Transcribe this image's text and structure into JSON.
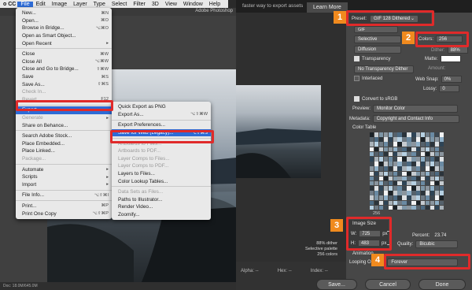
{
  "app": {
    "title": "Adobe Photoshop",
    "cc_tag": "o CC",
    "status": "Doc: 18.0M/645.0M"
  },
  "menubar": [
    "File",
    "Edit",
    "Image",
    "Layer",
    "Type",
    "Select",
    "Filter",
    "3D",
    "View",
    "Window",
    "Help"
  ],
  "file_menu": [
    {
      "label": "New...",
      "sc": "⌘N"
    },
    {
      "label": "Open...",
      "sc": "⌘O"
    },
    {
      "label": "Browse in Bridge...",
      "sc": "⌥⌘O"
    },
    {
      "label": "Open as Smart Object...",
      "sc": ""
    },
    {
      "label": "Open Recent",
      "sc": "▸"
    },
    {
      "sep": true
    },
    {
      "label": "Close",
      "sc": "⌘W"
    },
    {
      "label": "Close All",
      "sc": "⌥⌘W"
    },
    {
      "label": "Close and Go to Bridge...",
      "sc": "⇧⌘W"
    },
    {
      "label": "Save",
      "sc": "⌘S"
    },
    {
      "label": "Save As...",
      "sc": "⇧⌘S"
    },
    {
      "label": "Check In...",
      "sc": "",
      "dis": true
    },
    {
      "label": "Revert",
      "sc": "F12",
      "dis": true
    },
    {
      "sep": true
    },
    {
      "label": "Export",
      "sc": "▸",
      "hl": true
    },
    {
      "label": "Generate",
      "sc": "▸",
      "dis": true
    },
    {
      "label": "Share on Behance...",
      "sc": ""
    },
    {
      "sep": true
    },
    {
      "label": "Search Adobe Stock...",
      "sc": ""
    },
    {
      "label": "Place Embedded...",
      "sc": ""
    },
    {
      "label": "Place Linked...",
      "sc": ""
    },
    {
      "label": "Package...",
      "sc": "",
      "dis": true
    },
    {
      "sep": true
    },
    {
      "label": "Automate",
      "sc": "▸"
    },
    {
      "label": "Scripts",
      "sc": "▸"
    },
    {
      "label": "Import",
      "sc": "▸"
    },
    {
      "sep": true
    },
    {
      "label": "File Info...",
      "sc": "⌥⇧⌘I"
    },
    {
      "sep": true
    },
    {
      "label": "Print...",
      "sc": "⌘P"
    },
    {
      "label": "Print One Copy",
      "sc": "⌥⇧⌘P"
    }
  ],
  "export_menu": [
    {
      "label": "Quick Export as PNG",
      "sc": ""
    },
    {
      "label": "Export As...",
      "sc": "⌥⇧⌘W"
    },
    {
      "sep": true
    },
    {
      "label": "Export Preferences...",
      "sc": ""
    },
    {
      "label": "Save for Web (Legacy)...",
      "sc": "⌥⇧⌘S",
      "hl": true
    },
    {
      "sep": true
    },
    {
      "label": "Artboards to Files...",
      "sc": "",
      "dis": true
    },
    {
      "label": "Artboards to PDF...",
      "sc": "",
      "dis": true
    },
    {
      "label": "Layer Comps to Files...",
      "sc": "",
      "dis": true
    },
    {
      "label": "Layer Comps to PDF...",
      "sc": "",
      "dis": true
    },
    {
      "label": "Layers to Files...",
      "sc": ""
    },
    {
      "label": "Color Lookup Tables...",
      "sc": ""
    },
    {
      "sep": true
    },
    {
      "label": "Data Sets as Files...",
      "sc": "",
      "dis": true
    },
    {
      "label": "Paths to Illustrator...",
      "sc": ""
    },
    {
      "label": "Render Video...",
      "sc": ""
    },
    {
      "label": "Zoomify...",
      "sc": ""
    }
  ],
  "sfw": {
    "hint": "faster way to export assets",
    "learn_more": "Learn More",
    "preset_label": "Preset:",
    "preset_value": "GIF 128 Dithered",
    "format": "GIF",
    "reduction": "Selective",
    "colors_label": "Colors:",
    "colors_value": "256",
    "dither_algo": "Diffusion",
    "dither_label": "Dither:",
    "dither_value": "88%",
    "transparency": "Transparency",
    "matte_label": "Matte:",
    "trans_dither": "No Transparency Dither",
    "amount_label": "Amount:",
    "interlaced": "Interlaced",
    "websnap_label": "Web Snap:",
    "websnap_value": "0%",
    "lossy_label": "Lossy:",
    "lossy_value": "0",
    "convert_srgb": "Convert to sRGB",
    "preview_label": "Preview:",
    "preview_value": "Monitor Color",
    "metadata_label": "Metadata:",
    "metadata_value": "Copyright and Contact Info",
    "color_table": "Color Table",
    "count": "256",
    "image_size": "Image Size",
    "w_label": "W:",
    "w_value": "725",
    "h_label": "H:",
    "h_value": "483",
    "px": "px",
    "percent_label": "Percent:",
    "percent_value": "23.74",
    "quality_label": "Quality:",
    "quality_value": "Bicubic",
    "animation_label": "Animation",
    "looping_label": "Looping Options:",
    "looping_value": "Forever",
    "info_lines": [
      "88% dither",
      "Selective palette",
      "256 colors"
    ],
    "bottom": {
      "alpha": "Alpha: --",
      "hex": "Hex: --",
      "index": "Index: --"
    },
    "buttons": {
      "save": "Save...",
      "cancel": "Cancel",
      "done": "Done"
    },
    "matte_color": "#ffffff"
  },
  "badges": [
    "1",
    "2",
    "3",
    "4"
  ],
  "colors": {
    "highlight": "#2d6bd6",
    "callout": "#e02a2a",
    "badge": "#f08a1e"
  }
}
